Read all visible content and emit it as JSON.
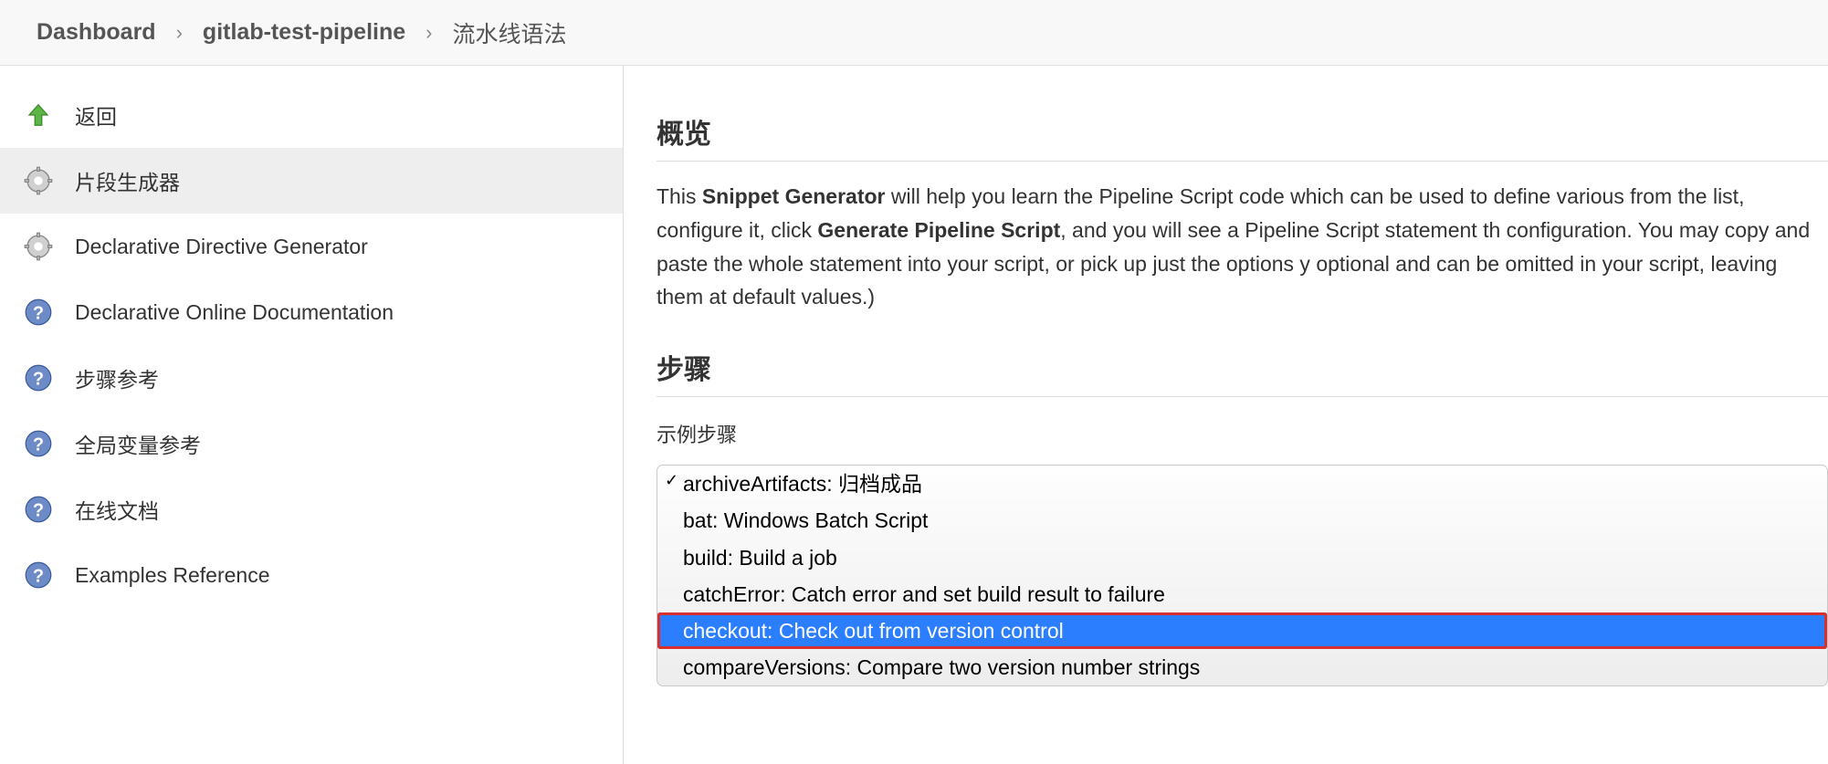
{
  "breadcrumb": {
    "items": [
      {
        "label": "Dashboard"
      },
      {
        "label": "gitlab-test-pipeline"
      },
      {
        "label": "流水线语法"
      }
    ],
    "separator": "›"
  },
  "sidebar": {
    "items": [
      {
        "label": "返回",
        "icon": "up-arrow-icon"
      },
      {
        "label": "片段生成器",
        "icon": "gear-icon",
        "active": true
      },
      {
        "label": "Declarative Directive Generator",
        "icon": "gear-icon"
      },
      {
        "label": "Declarative Online Documentation",
        "icon": "help-icon"
      },
      {
        "label": "步骤参考",
        "icon": "help-icon"
      },
      {
        "label": "全局变量参考",
        "icon": "help-icon"
      },
      {
        "label": "在线文档",
        "icon": "help-icon"
      },
      {
        "label": "Examples Reference",
        "icon": "help-icon"
      }
    ]
  },
  "content": {
    "overview_title": "概览",
    "overview_prefix": "This ",
    "overview_bold1": "Snippet Generator",
    "overview_mid1": " will help you learn the Pipeline Script code which can be used to define various from the list, configure it, click ",
    "overview_bold2": "Generate Pipeline Script",
    "overview_mid2": ", and you will see a Pipeline Script statement th configuration. You may copy and paste the whole statement into your script, or pick up just the options y optional and can be omitted in your script, leaving them at default values.)",
    "steps_title": "步骤",
    "sample_step_label": "示例步骤",
    "dropdown": {
      "options": [
        {
          "label": "archiveArtifacts: 归档成品",
          "checked": true
        },
        {
          "label": "bat: Windows Batch Script"
        },
        {
          "label": "build: Build a job"
        },
        {
          "label": "catchError: Catch error and set build result to failure"
        },
        {
          "label": "checkout: Check out from version control",
          "selected": true,
          "highlighted": true
        },
        {
          "label": "compareVersions: Compare two version number strings"
        }
      ]
    }
  }
}
